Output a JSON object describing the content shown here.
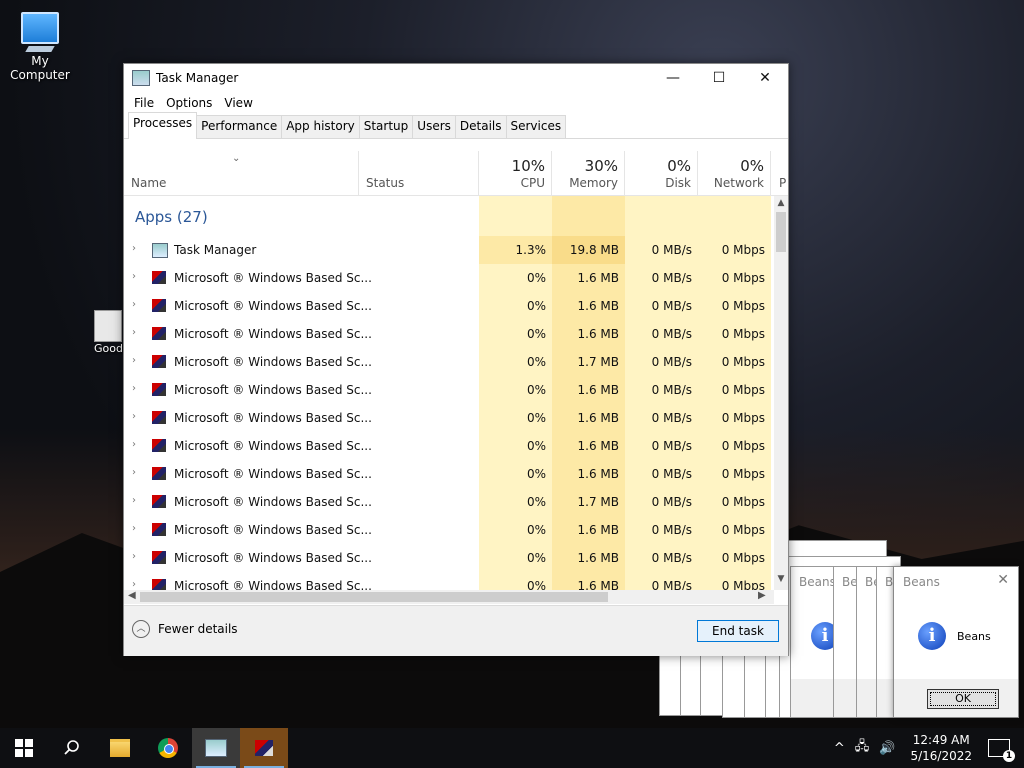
{
  "desktop": {
    "icons": [
      {
        "label": "My Computer"
      },
      {
        "label": "Good Chro"
      }
    ]
  },
  "task_manager": {
    "title": "Task Manager",
    "menu": [
      "File",
      "Options",
      "View"
    ],
    "tabs": [
      "Processes",
      "Performance",
      "App history",
      "Startup",
      "Users",
      "Details",
      "Services"
    ],
    "active_tab": "Processes",
    "columns": {
      "name": "Name",
      "status": "Status",
      "cpu": {
        "pct": "10%",
        "label": "CPU"
      },
      "memory": {
        "pct": "30%",
        "label": "Memory"
      },
      "disk": {
        "pct": "0%",
        "label": "Disk"
      },
      "network": {
        "pct": "0%",
        "label": "Network"
      },
      "power": "P"
    },
    "group_header": "Apps (27)",
    "rows": [
      {
        "name": "Task Manager",
        "icon": "task-manager-icon",
        "cpu": "1.3%",
        "memory": "19.8 MB",
        "disk": "0 MB/s",
        "network": "0 Mbps"
      },
      {
        "name": "Microsoft ® Windows Based Sc...",
        "icon": "script-host-icon",
        "cpu": "0%",
        "memory": "1.6 MB",
        "disk": "0 MB/s",
        "network": "0 Mbps"
      },
      {
        "name": "Microsoft ® Windows Based Sc...",
        "icon": "script-host-icon",
        "cpu": "0%",
        "memory": "1.6 MB",
        "disk": "0 MB/s",
        "network": "0 Mbps"
      },
      {
        "name": "Microsoft ® Windows Based Sc...",
        "icon": "script-host-icon",
        "cpu": "0%",
        "memory": "1.6 MB",
        "disk": "0 MB/s",
        "network": "0 Mbps"
      },
      {
        "name": "Microsoft ® Windows Based Sc...",
        "icon": "script-host-icon",
        "cpu": "0%",
        "memory": "1.7 MB",
        "disk": "0 MB/s",
        "network": "0 Mbps"
      },
      {
        "name": "Microsoft ® Windows Based Sc...",
        "icon": "script-host-icon",
        "cpu": "0%",
        "memory": "1.6 MB",
        "disk": "0 MB/s",
        "network": "0 Mbps"
      },
      {
        "name": "Microsoft ® Windows Based Sc...",
        "icon": "script-host-icon",
        "cpu": "0%",
        "memory": "1.6 MB",
        "disk": "0 MB/s",
        "network": "0 Mbps"
      },
      {
        "name": "Microsoft ® Windows Based Sc...",
        "icon": "script-host-icon",
        "cpu": "0%",
        "memory": "1.6 MB",
        "disk": "0 MB/s",
        "network": "0 Mbps"
      },
      {
        "name": "Microsoft ® Windows Based Sc...",
        "icon": "script-host-icon",
        "cpu": "0%",
        "memory": "1.6 MB",
        "disk": "0 MB/s",
        "network": "0 Mbps"
      },
      {
        "name": "Microsoft ® Windows Based Sc...",
        "icon": "script-host-icon",
        "cpu": "0%",
        "memory": "1.7 MB",
        "disk": "0 MB/s",
        "network": "0 Mbps"
      },
      {
        "name": "Microsoft ® Windows Based Sc...",
        "icon": "script-host-icon",
        "cpu": "0%",
        "memory": "1.6 MB",
        "disk": "0 MB/s",
        "network": "0 Mbps"
      },
      {
        "name": "Microsoft ® Windows Based Sc...",
        "icon": "script-host-icon",
        "cpu": "0%",
        "memory": "1.6 MB",
        "disk": "0 MB/s",
        "network": "0 Mbps"
      },
      {
        "name": "Microsoft ® Windows Based Sc...",
        "icon": "script-host-icon",
        "cpu": "0%",
        "memory": "1.6 MB",
        "disk": "0 MB/s",
        "network": "0 Mbps"
      }
    ],
    "footer": {
      "fewer_details": "Fewer details",
      "end_task": "End task"
    }
  },
  "beans_dialog": {
    "title": "Beans",
    "message": "Beans",
    "ok": "OK",
    "stacked_titles": [
      "Beans",
      "Be",
      "Be",
      "Be"
    ]
  },
  "taskbar": {
    "time": "12:49 AM",
    "date": "5/16/2022",
    "notification_count": "1"
  }
}
